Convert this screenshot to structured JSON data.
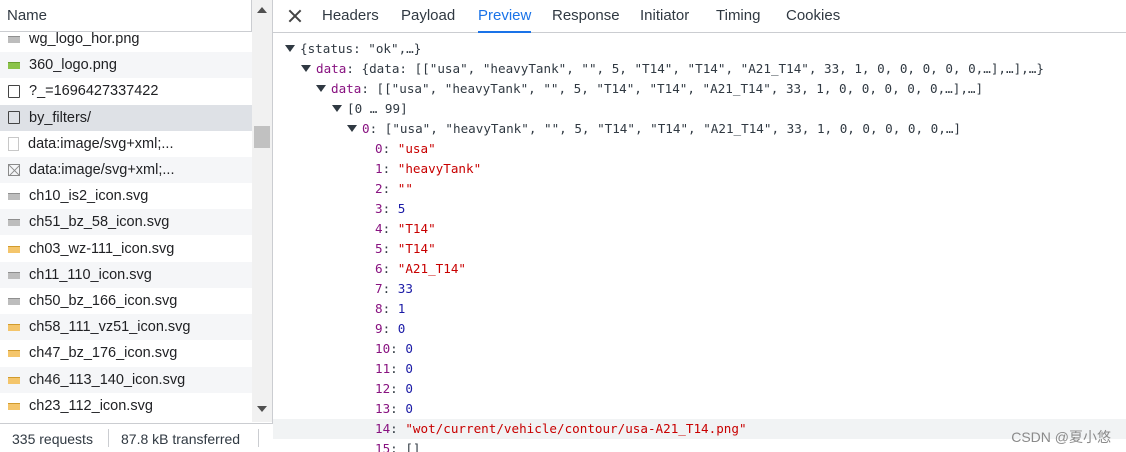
{
  "left_panel": {
    "column_header": "Name",
    "requests": [
      {
        "name": "wg_logo_hor.png",
        "icon": "image-gray-icon"
      },
      {
        "name": "360_logo.png",
        "icon": "image-green-icon"
      },
      {
        "name": "?_=1696427337422",
        "icon": "document-icon"
      },
      {
        "name": "by_filters/",
        "icon": "document-icon"
      },
      {
        "name": "data:image/svg+xml;...",
        "icon": "blank-file-icon"
      },
      {
        "name": "data:image/svg+xml;...",
        "icon": "broken-image-icon"
      },
      {
        "name": "ch10_is2_icon.svg",
        "icon": "image-gray-icon"
      },
      {
        "name": "ch51_bz_58_icon.svg",
        "icon": "image-gray-icon"
      },
      {
        "name": "ch03_wz-111_icon.svg",
        "icon": "image-orange-icon"
      },
      {
        "name": "ch11_110_icon.svg",
        "icon": "image-gray-icon"
      },
      {
        "name": "ch50_bz_166_icon.svg",
        "icon": "image-gray-icon"
      },
      {
        "name": "ch58_111_vz51_icon.svg",
        "icon": "image-orange-icon"
      },
      {
        "name": "ch47_bz_176_icon.svg",
        "icon": "image-orange-icon"
      },
      {
        "name": "ch46_113_140_icon.svg",
        "icon": "image-orange-icon"
      },
      {
        "name": "ch23_112_icon.svg",
        "icon": "image-orange-icon"
      }
    ],
    "selected_index": 3,
    "status": {
      "requests_count": "335 requests",
      "transferred": "87.8 kB transferred"
    }
  },
  "tabs": {
    "items": [
      "Headers",
      "Payload",
      "Preview",
      "Response",
      "Initiator",
      "Timing",
      "Cookies"
    ],
    "active": "Preview"
  },
  "preview": {
    "root": "{status: \"ok\",…}",
    "data_key": "data",
    "data_summary": "{data: [[\"usa\", \"heavyTank\", \"\", 5, \"T14\", \"T14\", \"A21_T14\", 33, 1, 0, 0, 0, 0, 0,…],…],…}",
    "inner_data_summary": "[[\"usa\", \"heavyTank\", \"\", 5, \"T14\", \"T14\", \"A21_T14\", 33, 1, 0, 0, 0, 0, 0,…],…]",
    "range": "[0 … 99]",
    "item0_key": "0",
    "item0_summary": "[\"usa\", \"heavyTank\", \"\", 5, \"T14\", \"T14\", \"A21_T14\", 33, 1, 0, 0, 0, 0, 0,…]",
    "entries": [
      {
        "key": "0",
        "value": "\"usa\"",
        "type": "str"
      },
      {
        "key": "1",
        "value": "\"heavyTank\"",
        "type": "str"
      },
      {
        "key": "2",
        "value": "\"\"",
        "type": "str"
      },
      {
        "key": "3",
        "value": "5",
        "type": "num"
      },
      {
        "key": "4",
        "value": "\"T14\"",
        "type": "str"
      },
      {
        "key": "5",
        "value": "\"T14\"",
        "type": "str"
      },
      {
        "key": "6",
        "value": "\"A21_T14\"",
        "type": "str"
      },
      {
        "key": "7",
        "value": "33",
        "type": "num"
      },
      {
        "key": "8",
        "value": "1",
        "type": "num"
      },
      {
        "key": "9",
        "value": "0",
        "type": "num"
      },
      {
        "key": "10",
        "value": "0",
        "type": "num"
      },
      {
        "key": "11",
        "value": "0",
        "type": "num"
      },
      {
        "key": "12",
        "value": "0",
        "type": "num"
      },
      {
        "key": "13",
        "value": "0",
        "type": "num"
      },
      {
        "key": "14",
        "value": "\"wot/current/vehicle/contour/usa-A21_T14.png\"",
        "type": "str"
      },
      {
        "key": "15",
        "value": "[]",
        "type": "plain"
      }
    ],
    "highlighted_index": 14
  },
  "watermark": "CSDN @夏小悠"
}
